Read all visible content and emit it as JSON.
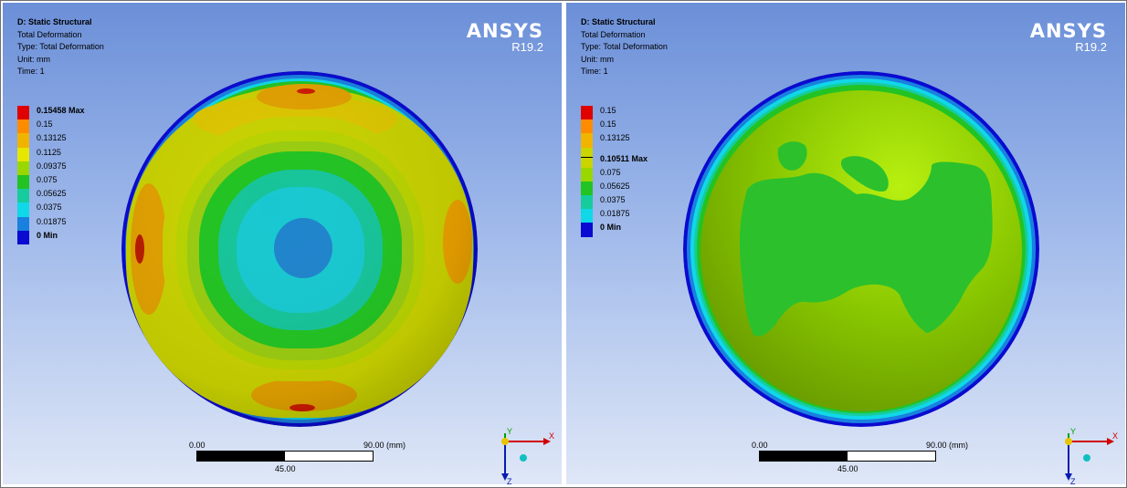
{
  "panels": [
    {
      "info": {
        "title": "D: Static Structural",
        "result": "Total Deformation",
        "type": "Type: Total Deformation",
        "unit": "Unit: mm",
        "time": "Time: 1"
      },
      "brand": {
        "logo": "ANSYS",
        "version": "R19.2"
      },
      "legend": [
        {
          "label": "0.15458 Max",
          "color": "#e00000",
          "bold": true
        },
        {
          "label": "0.15",
          "color": "#ff8c00",
          "bold": false
        },
        {
          "label": "0.13125",
          "color": "#f0b400",
          "bold": false
        },
        {
          "label": "0.1125",
          "color": "#e6e600",
          "bold": false
        },
        {
          "label": "0.09375",
          "color": "#9ad600",
          "bold": false
        },
        {
          "label": "0.075",
          "color": "#22c322",
          "bold": false
        },
        {
          "label": "0.05625",
          "color": "#16cc9c",
          "bold": false
        },
        {
          "label": "0.0375",
          "color": "#10d8e8",
          "bold": false
        },
        {
          "label": "0.01875",
          "color": "#1a80e0",
          "bold": false
        },
        {
          "label": "0 Min",
          "color": "#0a0ad0",
          "bold": true
        }
      ],
      "scale": {
        "start": "0.00",
        "end": "90.00 (mm)",
        "mid": "45.00"
      },
      "triad": {
        "x": "X",
        "y": "Y",
        "z": "Z"
      }
    },
    {
      "info": {
        "title": "D: Static Structural",
        "result": "Total Deformation",
        "type": "Type: Total Deformation",
        "unit": "Unit: mm",
        "time": "Time: 1"
      },
      "brand": {
        "logo": "ANSYS",
        "version": "R19.2"
      },
      "legend": [
        {
          "label": "0.15",
          "color": "#e00000",
          "bold": false
        },
        {
          "label": "0.15",
          "color": "#ff8c00",
          "bold": false
        },
        {
          "label": "0.13125",
          "color": "#f0b400",
          "bold": false
        },
        {
          "label": "0.10511 Max",
          "color": "#e6e600",
          "bold": true
        },
        {
          "label": "0.075",
          "color": "#9ad600",
          "bold": false
        },
        {
          "label": "0.05625",
          "color": "#22c322",
          "bold": false
        },
        {
          "label": "0.0375",
          "color": "#16cc9c",
          "bold": false
        },
        {
          "label": "0.01875",
          "color": "#10d8e8",
          "bold": false
        },
        {
          "label": "0 Min",
          "color": "#0a0ad0",
          "bold": true
        }
      ],
      "scale": {
        "start": "0.00",
        "end": "90.00 (mm)",
        "mid": "45.00"
      },
      "triad": {
        "x": "X",
        "y": "Y",
        "z": "Z"
      }
    }
  ]
}
